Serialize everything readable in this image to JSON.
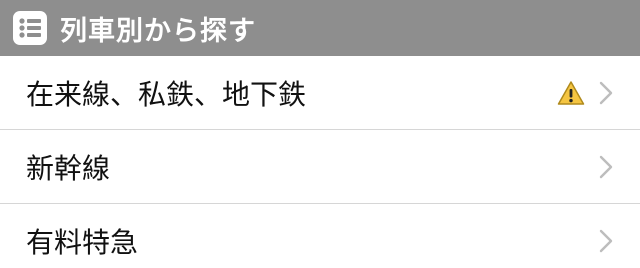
{
  "header": {
    "title": "列車別から探す",
    "icon": "list-icon"
  },
  "rows": [
    {
      "label": "在来線、私鉄、地下鉄",
      "has_warning": true,
      "warning_icon": "warning-icon",
      "chevron_icon": "chevron-right-icon"
    },
    {
      "label": "新幹線",
      "has_warning": false,
      "chevron_icon": "chevron-right-icon"
    },
    {
      "label": "有料特急",
      "has_warning": false,
      "chevron_icon": "chevron-right-icon"
    }
  ],
  "colors": {
    "header_bg": "#8e8e8e",
    "header_text": "#ffffff",
    "warning_fill": "#f5c542",
    "chevron": "#bdbdbd",
    "divider": "#d6d6d6"
  }
}
